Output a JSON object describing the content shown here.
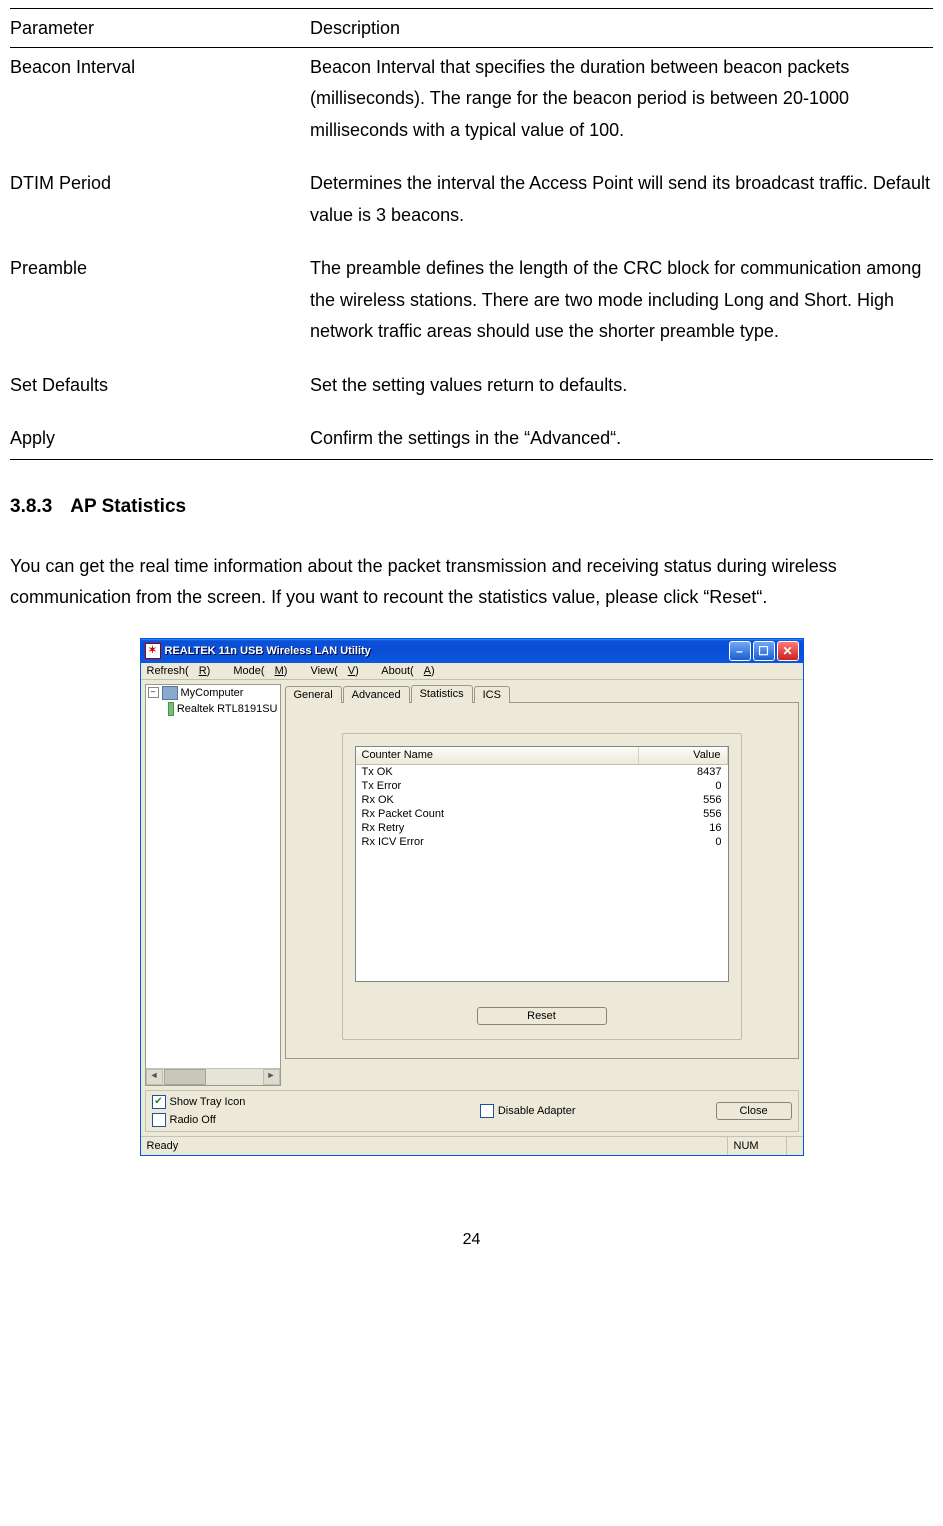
{
  "param_table": {
    "headers": {
      "param": "Parameter",
      "desc": "Description"
    },
    "rows": [
      {
        "param": "Beacon Interval",
        "desc": "Beacon Interval that specifies the duration between beacon packets (milliseconds). The range for the beacon period is between 20-1000 milliseconds with a typical value of 100."
      },
      {
        "param": "DTIM Period",
        "desc": "Determines the interval the Access Point will send its broadcast traffic. Default value is 3 beacons."
      },
      {
        "param": "Preamble",
        "desc": "The preamble defines the length of the CRC block for communication among the wireless stations. There are two mode including Long and Short. High network traffic areas should use the shorter preamble type."
      },
      {
        "param": "Set Defaults",
        "desc": "Set the setting values return to defaults."
      },
      {
        "param": "Apply",
        "desc": "Confirm the settings in the “Advanced“."
      }
    ]
  },
  "section": {
    "number": "3.8.3",
    "title": "AP Statistics"
  },
  "paragraph": "You can get the real time information about the packet transmission and receiving status during wireless communication from the screen. If you want to recount the statistics value, please click “Reset“.",
  "app": {
    "title": "REALTEK 11n USB Wireless LAN Utility",
    "menus": [
      {
        "pre": "Refresh(",
        "ul": "R",
        "post": ")"
      },
      {
        "pre": "Mode(",
        "ul": "M",
        "post": ")"
      },
      {
        "pre": "View(",
        "ul": "V",
        "post": ")"
      },
      {
        "pre": "About(",
        "ul": "A",
        "post": ")"
      }
    ],
    "tree": {
      "root": "MyComputer",
      "child": "Realtek RTL8191SU"
    },
    "tabs": [
      "General",
      "Advanced",
      "Statistics",
      "ICS"
    ],
    "active_tab": 2,
    "stats": {
      "headers": {
        "name": "Counter Name",
        "value": "Value"
      },
      "rows": [
        {
          "name": "Tx OK",
          "value": "8437"
        },
        {
          "name": "Tx Error",
          "value": "0"
        },
        {
          "name": "Rx OK",
          "value": "556"
        },
        {
          "name": "Rx Packet Count",
          "value": "556"
        },
        {
          "name": "Rx Retry",
          "value": "16"
        },
        {
          "name": "Rx ICV Error",
          "value": "0"
        }
      ],
      "reset": "Reset"
    },
    "bottom": {
      "show_tray": "Show Tray Icon",
      "radio_off": "Radio Off",
      "disable_adapter": "Disable Adapter",
      "close": "Close"
    },
    "status": {
      "ready": "Ready",
      "num": "NUM"
    }
  },
  "page_number": "24"
}
